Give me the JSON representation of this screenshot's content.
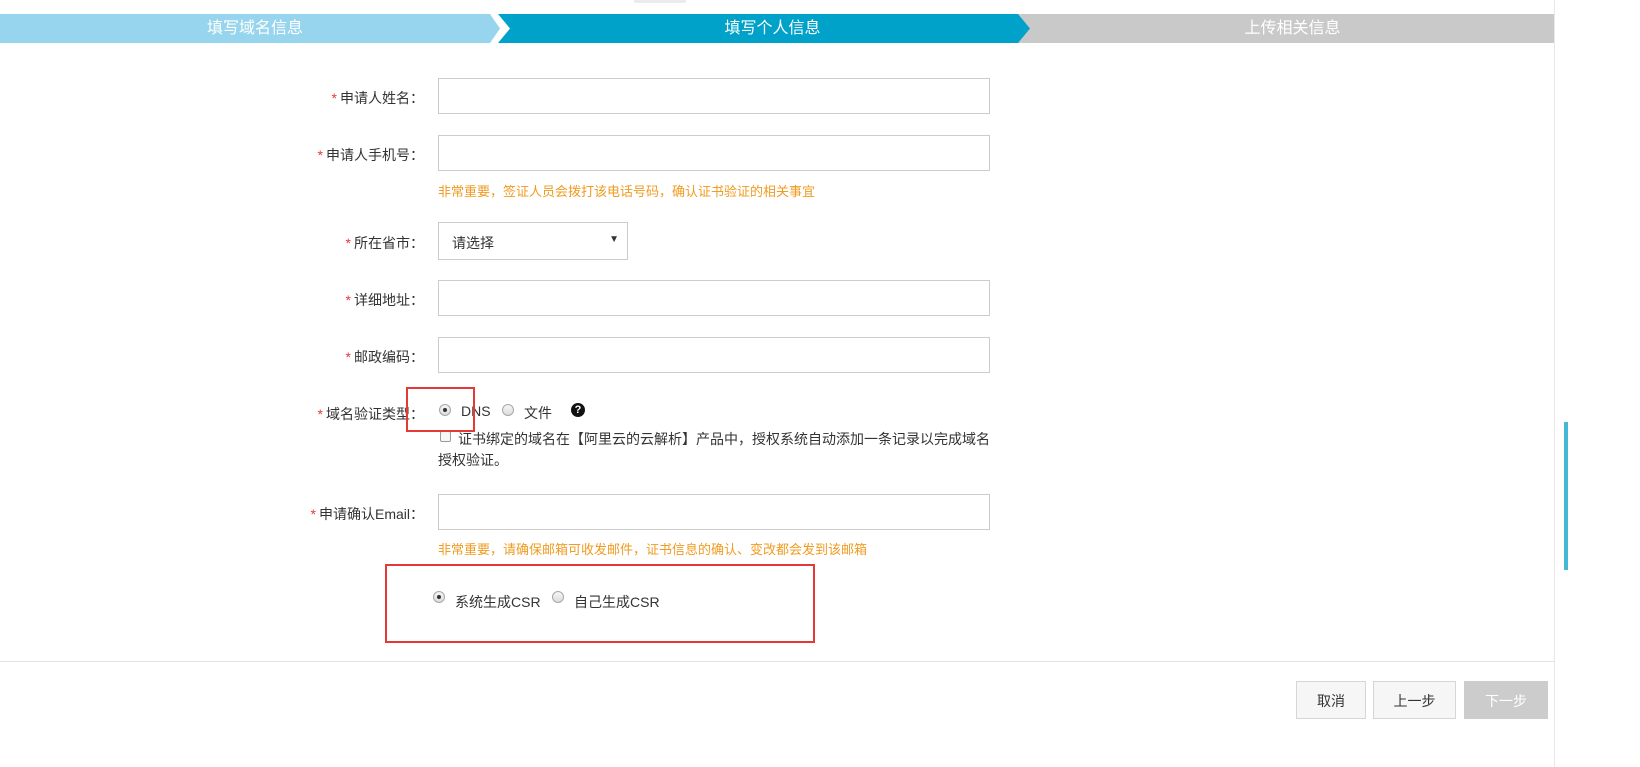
{
  "steps": [
    {
      "label": "填写域名信息",
      "state": "done"
    },
    {
      "label": "填写个人信息",
      "state": "active"
    },
    {
      "label": "上传相关信息",
      "state": "pending"
    }
  ],
  "required_mark": "*",
  "form": {
    "name": {
      "label": "申请人姓名：",
      "value": ""
    },
    "phone": {
      "label": "申请人手机号：",
      "value": "",
      "hint": "非常重要，签证人员会拨打该电话号码，确认证书验证的相关事宜"
    },
    "province": {
      "label": "所在省市：",
      "selected": "请选择"
    },
    "address": {
      "label": "详细地址：",
      "value": ""
    },
    "postcode": {
      "label": "邮政编码：",
      "value": ""
    },
    "verify_type": {
      "label": "域名验证类型：",
      "options": [
        "DNS",
        "文件"
      ],
      "selected": "DNS",
      "auto_dns_text": "证书绑定的域名在【阿里云的云解析】产品中，授权系统自动添加一条记录以完成域名授权验证。"
    },
    "email": {
      "label": "申请确认Email：",
      "value": "",
      "hint": "非常重要，请确保邮箱可收发邮件，证书信息的确认、变改都会发到该邮箱"
    },
    "csr": {
      "options": [
        "系统生成CSR",
        "自己生成CSR"
      ],
      "selected": "系统生成CSR"
    }
  },
  "buttons": {
    "cancel": "取消",
    "prev": "上一步",
    "next": "下一步"
  },
  "icons": {
    "help": "?",
    "caret": "▼"
  },
  "colors": {
    "step_done": "#97d5ee",
    "step_active": "#00a2ca",
    "step_pending": "#c9c9c9",
    "hint": "#f09b21",
    "required": "#e4393c",
    "highlight": "#e53935"
  }
}
